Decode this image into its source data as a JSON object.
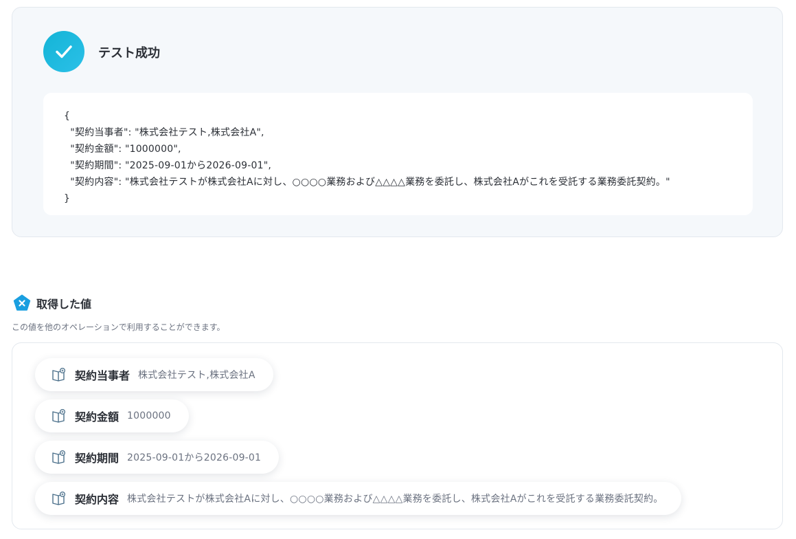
{
  "test_result": {
    "title": "テスト成功",
    "json_lines": [
      "{",
      "  \"契約当事者\": \"株式会社テスト,株式会社A\",",
      "  \"契約金額\": \"1000000\",",
      "  \"契約期間\": \"2025-09-01から2026-09-01\",",
      "  \"契約内容\": \"株式会社テストが株式会社Aに対し、○○○○業務および△△△△業務を委託し、株式会社Aがこれを受託する業務委託契約。\"",
      "}"
    ]
  },
  "values_section": {
    "title": "取得した値",
    "description": "この値を他のオペレーションで利用することができます。",
    "items": [
      {
        "key": "契約当事者",
        "value": "株式会社テスト,株式会社A"
      },
      {
        "key": "契約金額",
        "value": "1000000"
      },
      {
        "key": "契約期間",
        "value": "2025-09-01から2026-09-01"
      },
      {
        "key": "契約内容",
        "value": "株式会社テストが株式会社Aに対し、○○○○業務および△△△△業務を委託し、株式会社Aがこれを受託する業務委託契約。"
      }
    ]
  },
  "colors": {
    "accent": "#14b4d6",
    "panel_bg": "#f5f8fb",
    "badge": "#1a9fe0"
  },
  "icons": {
    "success": "check-icon",
    "section": "x-badge-icon",
    "value": "book-icon"
  }
}
